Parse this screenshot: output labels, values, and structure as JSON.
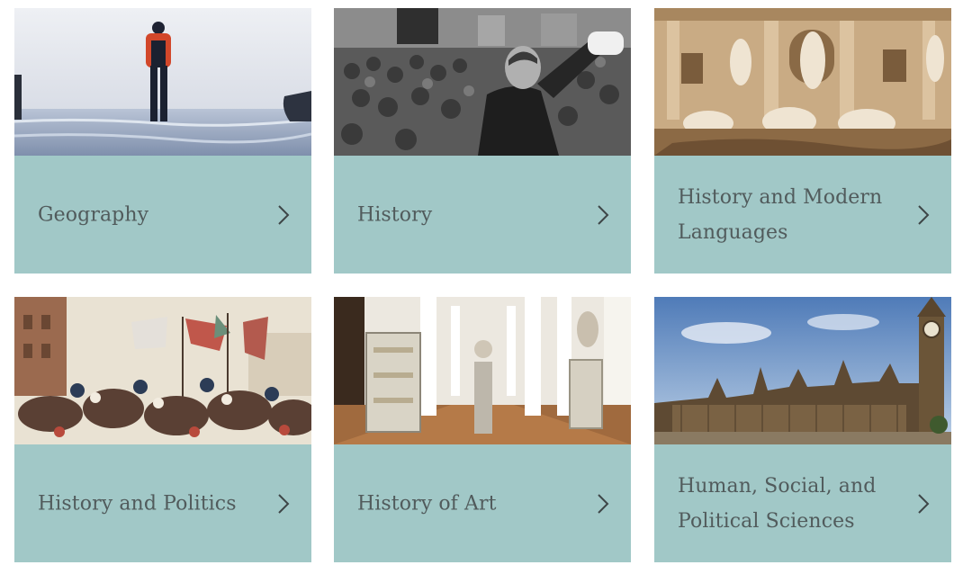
{
  "subjects": [
    {
      "label": "Geography",
      "image": "arctic-ice-explorer-photo"
    },
    {
      "label": "History",
      "image": "revolution-crowd-speech-photo"
    },
    {
      "label": "History and Modern Languages",
      "image": "baroque-fountain-statues-photo"
    },
    {
      "label": "History and Politics",
      "image": "historic-battle-painting"
    },
    {
      "label": "History of Art",
      "image": "museum-gallery-hall-photo"
    },
    {
      "label": "Human, Social, and Political Sciences",
      "image": "parliament-building-photo"
    }
  ],
  "icons": {
    "card_arrow": "chevron-right-icon"
  },
  "colors": {
    "panel": "#a1c8c7",
    "label_text": "#515b5c"
  }
}
